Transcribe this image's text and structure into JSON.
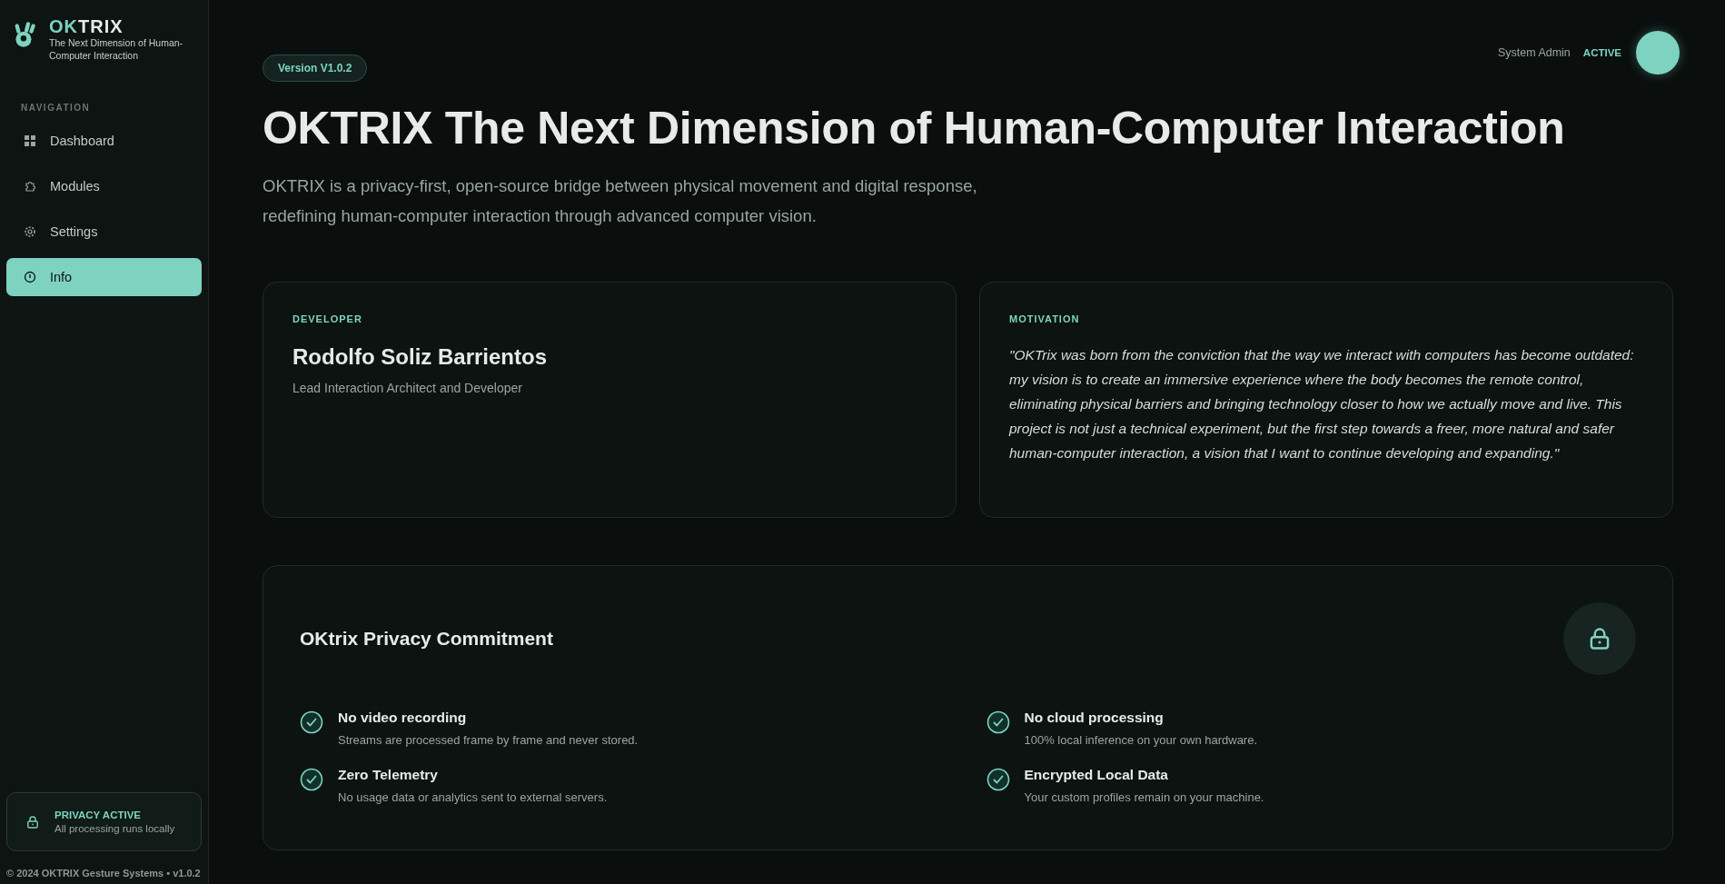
{
  "sidebar": {
    "logo": {
      "accent": "OK",
      "rest": "TRIX",
      "tagline": "The Next Dimension of Human-Computer Interaction"
    },
    "section_label": "NAVIGATION",
    "items": [
      {
        "label": "Dashboard",
        "selected": false
      },
      {
        "label": "Modules",
        "selected": false
      },
      {
        "label": "Settings",
        "selected": false
      },
      {
        "label": "Info",
        "selected": true
      }
    ],
    "privacy_status": {
      "title": "PRIVACY ACTIVE",
      "text": "All processing runs locally"
    },
    "footer": "© 2024 OKTRIX Gesture Systems • v1.0.2"
  },
  "header": {
    "version": "Version V1.0.2",
    "user": "System Admin",
    "status": "ACTIVE"
  },
  "hero": {
    "title": "OKTRIX The Next Dimension of Human-Computer Interaction",
    "description": "OKTRIX is a privacy-first, open-source bridge between physical movement and digital response, redefining human-computer interaction through advanced computer vision."
  },
  "cards": [
    {
      "kind": "person",
      "label": "DEVELOPER",
      "name": "Rodolfo Soliz Barrientos",
      "role": "Lead Interaction Architect and Developer"
    },
    {
      "kind": "quote",
      "label": "MOTIVATION",
      "text": "\"OKTrix was born from the conviction that the way we interact with computers has become outdated: my vision is to create an immersive experience where the body becomes the remote control, eliminating physical barriers and bringing technology closer to how we actually move and live. This project is not just a technical experiment, but the first step towards a freer, more natural and safer human-computer interaction, a vision that I want to continue developing and expanding.\""
    }
  ],
  "privacy": {
    "title": "OKtrix Privacy Commitment",
    "items": [
      {
        "title": "No video recording",
        "text": "Streams are processed frame by frame and never stored.",
        "checked": true
      },
      {
        "title": "No cloud processing",
        "text": "100% local inference on your own hardware.",
        "checked": true
      },
      {
        "title": "Zero Telemetry",
        "text": "No usage data or analytics sent to external servers.",
        "checked": true
      },
      {
        "title": "Encrypted Local Data",
        "text": "Your custom profiles remain on your machine.",
        "checked": true
      }
    ]
  }
}
